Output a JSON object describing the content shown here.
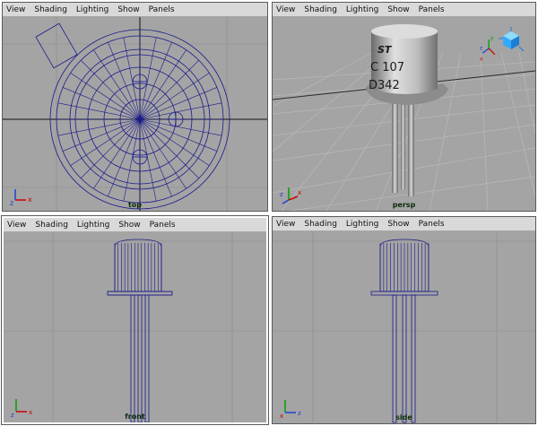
{
  "menu": [
    "View",
    "Shading",
    "Lighting",
    "Show",
    "Panels"
  ],
  "panels": {
    "top": {
      "camera": "top"
    },
    "persp": {
      "camera": "persp",
      "text_line1": "C 107",
      "text_line2": "D342",
      "logo": "ST"
    },
    "front": {
      "camera": "front"
    },
    "side": {
      "camera": "side"
    }
  },
  "axes": {
    "x": "x",
    "y": "y",
    "z": "z"
  },
  "colors": {
    "wire": "#1a1a8c",
    "grid": "#8a8a8a",
    "axis_x": "#d00000",
    "axis_y": "#00a000",
    "axis_z": "#2040d0",
    "bg": "#a4a4a4"
  }
}
